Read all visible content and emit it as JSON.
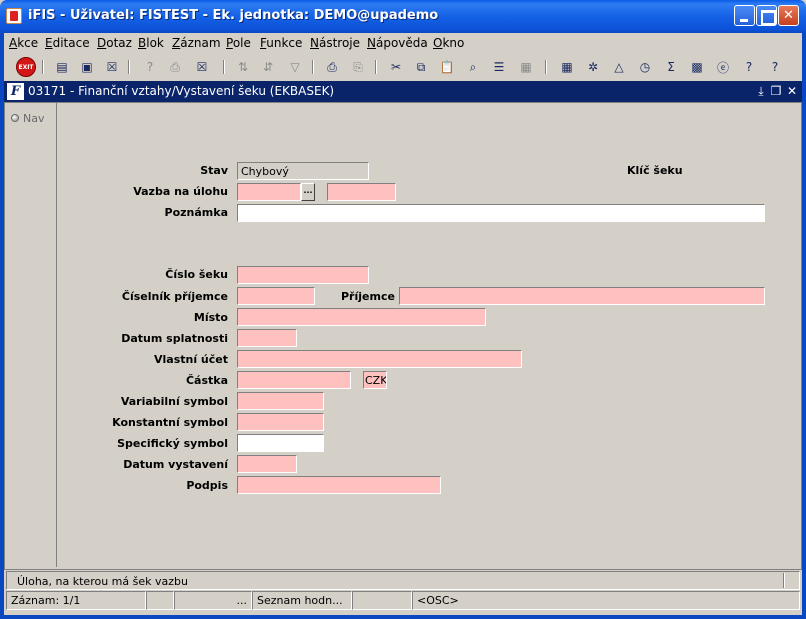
{
  "window": {
    "title": "iFIS - Uživatel: FISTEST - Ek. jednotka: DEMO@upademo"
  },
  "menu": [
    {
      "label": "Akce"
    },
    {
      "label": "Editace"
    },
    {
      "label": "Dotaz"
    },
    {
      "label": "Blok"
    },
    {
      "label": "Záznam"
    },
    {
      "label": "Pole"
    },
    {
      "label": "Funkce"
    },
    {
      "label": "Nástroje"
    },
    {
      "label": "Nápověda"
    },
    {
      "label": "Okno"
    }
  ],
  "toolbar": {
    "exit_label": "EXIT",
    "icons": [
      "exit-icon",
      "insert-record-icon",
      "save-icon",
      "delete-record-icon",
      "enter-query-icon",
      "execute-query-icon",
      "cancel-query-icon",
      "sort-asc-icon",
      "sort-desc-icon",
      "filter-icon",
      "print-icon",
      "print-preview-icon",
      "cut-icon",
      "copy-icon",
      "paste-icon",
      "find-icon",
      "list-icon",
      "grid-icon",
      "calculator-icon",
      "wheel-icon",
      "chart-icon",
      "clock-icon",
      "sum-icon",
      "excel-icon",
      "internet-explorer-icon",
      "help-question-icon",
      "help-icon"
    ]
  },
  "form": {
    "title": "03171 - Finanční vztahy/Vystavení šeku (EKBASEK)",
    "nav_label": "Nav",
    "fields": {
      "stav": {
        "label": "Stav",
        "value": "Chybový"
      },
      "klic_seku": {
        "label": "Klíč šeku"
      },
      "vazba_na_ulohu": {
        "label": "Vazba na úlohu",
        "value": "",
        "value2": "",
        "lov": "..."
      },
      "poznamka": {
        "label": "Poznámka",
        "value": ""
      },
      "cislo_seku": {
        "label": "Číslo šeku",
        "value": ""
      },
      "ciselnik_prijemce": {
        "label": "Číselník příjemce",
        "value": ""
      },
      "prijemce": {
        "label": "Příjemce",
        "value": ""
      },
      "misto": {
        "label": "Místo",
        "value": ""
      },
      "datum_splatnosti": {
        "label": "Datum splatnosti",
        "value": ""
      },
      "vlastni_ucet": {
        "label": "Vlastní účet",
        "value": ""
      },
      "castka": {
        "label": "Částka",
        "value": "",
        "currency": "CZK"
      },
      "variabilni_symbol": {
        "label": "Variabilní symbol",
        "value": ""
      },
      "konstantni_symbol": {
        "label": "Konstantní symbol",
        "value": ""
      },
      "specificky_symbol": {
        "label": "Specifický symbol",
        "value": ""
      },
      "datum_vystaveni": {
        "label": "Datum vystavení",
        "value": ""
      },
      "podpis": {
        "label": "Podpis",
        "value": ""
      }
    }
  },
  "status": {
    "hint": "Úloha, na kterou má šek vazbu",
    "record": "Záznam: 1/1",
    "dots": "...",
    "list_values": "Seznam hodn...",
    "mode": "<OSC>"
  },
  "colors": {
    "required_field": "#ffc0c0",
    "form_bg": "#d4d0c8",
    "title_bar": "#0a48c2",
    "form_title_bar": "#0a246a"
  }
}
